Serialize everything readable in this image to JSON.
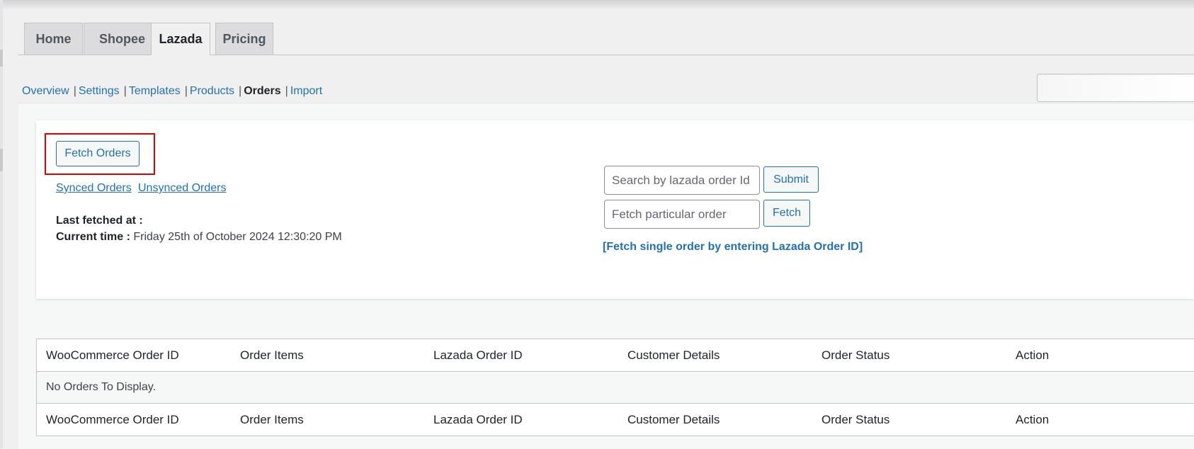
{
  "tabs": [
    {
      "label": "Home",
      "active": false
    },
    {
      "label": "Shopee",
      "active": false
    },
    {
      "label": "Lazada",
      "active": true
    },
    {
      "label": "Pricing",
      "active": false
    }
  ],
  "subnav": {
    "overview": "Overview",
    "settings": "Settings",
    "templates": "Templates",
    "products": "Products",
    "orders": "Orders",
    "import": "Import",
    "separator": "|"
  },
  "fetch_panel": {
    "fetch_button": "Fetch Orders",
    "synced_link": "Synced Orders",
    "unsynced_link": "Unsynced Orders",
    "last_fetched_label": "Last fetched at :",
    "last_fetched_value": "",
    "current_time_label": "Current time :",
    "current_time_value": "Friday 25th of October 2024 12:30:20 PM"
  },
  "search": {
    "search_placeholder": "Search by lazada order Id",
    "submit_label": "Submit",
    "fetch_placeholder": "Fetch particular order",
    "fetch_label": "Fetch",
    "hint": "[Fetch single order by entering Lazada Order ID]"
  },
  "table": {
    "columns": [
      "WooCommerce Order ID",
      "Order Items",
      "Lazada Order ID",
      "Customer Details",
      "Order Status",
      "Action"
    ],
    "empty_message": "No Orders To Display."
  },
  "colors": {
    "accent": "#2271b1",
    "highlight": "#e00000",
    "background": "#f0f0f1"
  }
}
